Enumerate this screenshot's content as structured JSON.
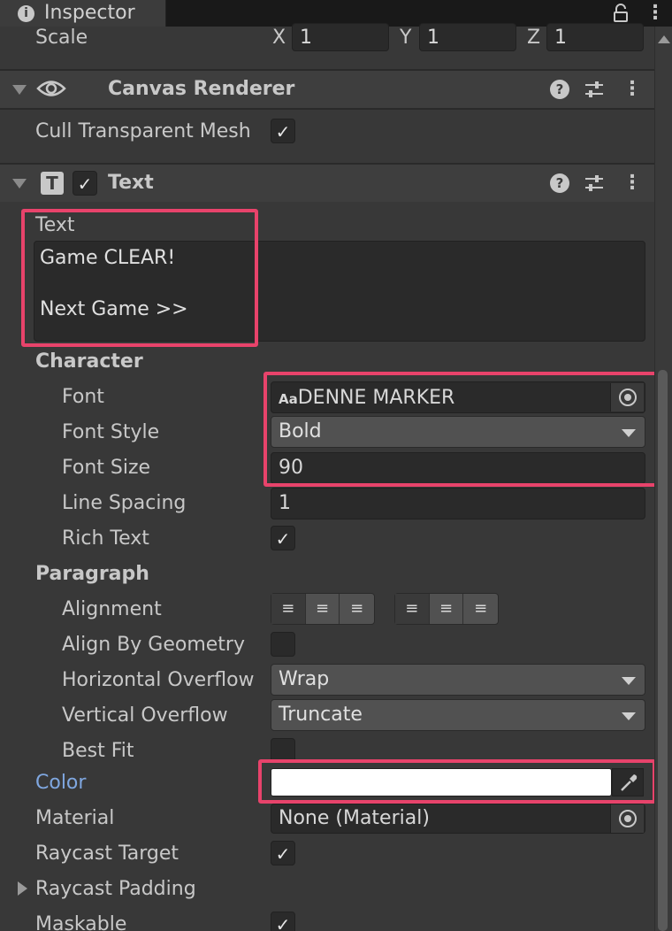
{
  "tab": {
    "title": "Inspector",
    "info_icon": "i"
  },
  "scale": {
    "label": "Scale",
    "x_label": "X",
    "x_value": "1",
    "y_label": "Y",
    "y_value": "1",
    "z_label": "Z",
    "z_value": "1"
  },
  "canvas_renderer": {
    "title": "Canvas Renderer",
    "cull_label": "Cull Transparent Mesh",
    "cull_checked": true
  },
  "text_component": {
    "title": "Text",
    "type_icon": "T",
    "text_label": "Text",
    "text_line1": "Game CLEAR!",
    "text_line2": "Next Game >>",
    "character_header": "Character",
    "font_label": "Font",
    "font_icon": "Aa",
    "font_value": "DENNE MARKER",
    "font_style_label": "Font Style",
    "font_style_value": "Bold",
    "font_size_label": "Font Size",
    "font_size_value": "90",
    "line_spacing_label": "Line Spacing",
    "line_spacing_value": "1",
    "rich_text_label": "Rich Text",
    "rich_text_checked": true,
    "paragraph_header": "Paragraph",
    "alignment_label": "Alignment",
    "align_by_geometry_label": "Align By Geometry",
    "align_by_geometry_checked": false,
    "h_overflow_label": "Horizontal Overflow",
    "h_overflow_value": "Wrap",
    "v_overflow_label": "Vertical Overflow",
    "v_overflow_value": "Truncate",
    "best_fit_label": "Best Fit",
    "best_fit_checked": false,
    "color_label": "Color",
    "color_value": "#ffffff",
    "material_label": "Material",
    "material_value": "None (Material)",
    "raycast_target_label": "Raycast Target",
    "raycast_target_checked": true,
    "raycast_padding_label": "Raycast Padding",
    "maskable_label": "Maskable",
    "maskable_checked": true
  },
  "colors": {
    "highlight": "#e8436b",
    "color_label": "#7fa7e0"
  },
  "icons": {
    "lock": "lock-icon",
    "eye": "eye-icon",
    "help": "help-icon",
    "presets": "presets-icon",
    "menu": "kebab-menu-icon",
    "eyedropper": "eyedropper-icon",
    "picker": "object-picker-icon"
  }
}
